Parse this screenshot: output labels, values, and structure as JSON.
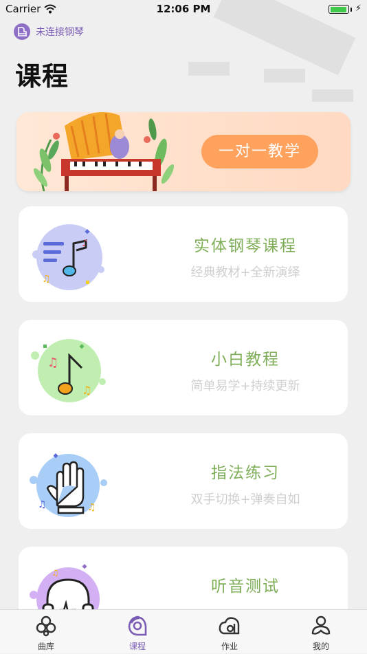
{
  "status_bar": {
    "carrier": "Carrier",
    "time": "12:06 PM",
    "battery_level": 0.95
  },
  "piano_status": {
    "label": "未连接钢琴",
    "color": "#8e6fc6"
  },
  "page_title": "课程",
  "banner": {
    "button_label": "一对一教学",
    "button_color": "#ffa25e",
    "background": "#ffe3cf"
  },
  "courses": [
    {
      "title": "实体钢琴课程",
      "subtitle": "经典教材+全新演绎",
      "icon": "music-notes-icon",
      "icon_color": "#c9cdf6"
    },
    {
      "title": "小白教程",
      "subtitle": "简单易学+持续更新",
      "icon": "music-note-icon",
      "icon_color": "#bfeeb0"
    },
    {
      "title": "指法练习",
      "subtitle": "双手切换+弹奏自如",
      "icon": "hand-icon",
      "icon_color": "#a8cdf6"
    },
    {
      "title": "听音测试",
      "subtitle": "",
      "icon": "headphones-icon",
      "icon_color": "#d2b0f3"
    }
  ],
  "tabs": [
    {
      "label": "曲库",
      "icon": "library-icon"
    },
    {
      "label": "课程",
      "icon": "course-icon",
      "active": true
    },
    {
      "label": "作业",
      "icon": "homework-icon"
    },
    {
      "label": "我的",
      "icon": "profile-icon"
    }
  ],
  "colors": {
    "title_green": "#7fae58",
    "accent_purple": "#7a5cb5"
  }
}
